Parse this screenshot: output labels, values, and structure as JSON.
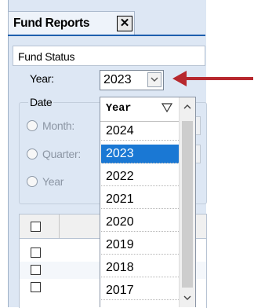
{
  "tab": {
    "title": "Fund Reports",
    "close_glyph": "✕"
  },
  "report_name": "Fund Status",
  "year_field": {
    "label": "Year:",
    "value": "2023"
  },
  "date_group": {
    "label": "Date",
    "options": [
      {
        "label": "Month:"
      },
      {
        "label": "Quarter:"
      },
      {
        "label": "Year"
      }
    ]
  },
  "year_dropdown": {
    "header": "Year",
    "items": [
      "2024",
      "2023",
      "2022",
      "2021",
      "2020",
      "2019",
      "2018",
      "2017"
    ],
    "selected": "2023"
  },
  "colors": {
    "highlight": "#1a78d4",
    "arrow": "#b7282e",
    "panel": "#dde7f4",
    "tab_underline": "#1e5fae"
  },
  "icons": [
    "close-icon",
    "chevron-down-icon",
    "filter-icon",
    "chevron-up-icon",
    "red-arrow-icon"
  ]
}
